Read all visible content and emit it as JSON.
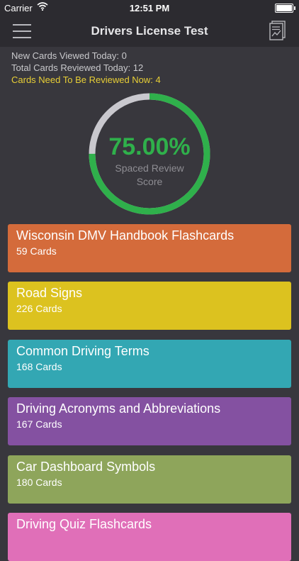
{
  "status_bar": {
    "carrier": "Carrier",
    "time": "12:51 PM"
  },
  "nav": {
    "title": "Drivers License Test",
    "menu_icon": "hamburger-menu-icon",
    "report_icon": "report-chart-icon"
  },
  "stats": {
    "new_cards": "New Cards Viewed Today: 0",
    "total_reviewed": "Total Cards Reviewed Today: 12",
    "need_review": "Cards Need To Be Reviewed Now: 4"
  },
  "score": {
    "value_text": "75.00%",
    "fraction": 0.75,
    "label_line1": "Spaced Review",
    "label_line2": "Score",
    "colors": {
      "progress": "#2fb04b",
      "track": "#c9c8ce"
    }
  },
  "decks": [
    {
      "name": "Wisconsin DMV Handbook Flashcards",
      "count": "59 Cards",
      "color": "#d46b3b"
    },
    {
      "name": "Road Signs",
      "count": "226 Cards",
      "color": "#dcc21f"
    },
    {
      "name": "Common Driving Terms",
      "count": "168 Cards",
      "color": "#33a7b3"
    },
    {
      "name": "Driving Acronyms and Abbreviations",
      "count": "167 Cards",
      "color": "#8451a1"
    },
    {
      "name": "Car Dashboard Symbols",
      "count": "180 Cards",
      "color": "#8ea55b"
    },
    {
      "name": "Driving Quiz Flashcards",
      "count": "",
      "color": "#e06fb8"
    }
  ]
}
